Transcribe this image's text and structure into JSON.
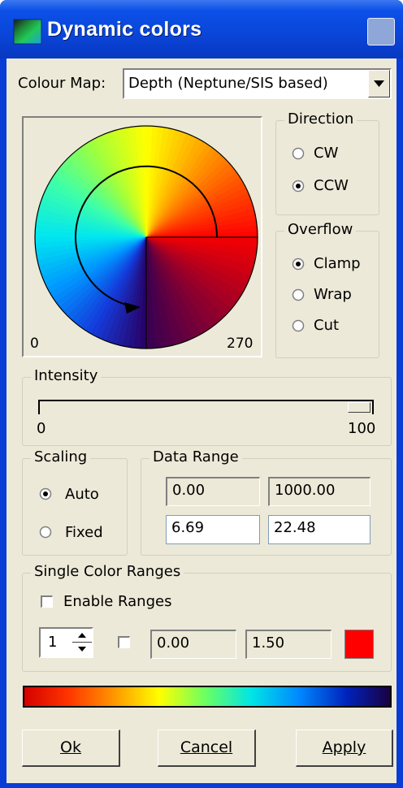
{
  "window": {
    "title": "Dynamic colors"
  },
  "colour_map": {
    "label": "Colour Map:",
    "selected": "Depth (Neptune/SIS based)"
  },
  "wheel": {
    "min_label": "0",
    "max_label": "270",
    "start_angle_deg": 0,
    "end_angle_deg": 270
  },
  "direction": {
    "title": "Direction",
    "options": [
      "CW",
      "CCW"
    ],
    "selected": "CCW"
  },
  "overflow": {
    "title": "Overflow",
    "options": [
      "Clamp",
      "Wrap",
      "Cut"
    ],
    "selected": "Clamp"
  },
  "intensity": {
    "title": "Intensity",
    "min": "0",
    "max": "100",
    "value": 100
  },
  "scaling": {
    "title": "Scaling",
    "options": [
      "Auto",
      "Fixed"
    ],
    "selected": "Auto"
  },
  "data_range": {
    "title": "Data Range",
    "min": "0.00",
    "max": "1000.00",
    "low": "6.69",
    "high": "22.48"
  },
  "single_color_ranges": {
    "title": "Single Color Ranges",
    "enable_label": "Enable Ranges",
    "enabled": false,
    "index": "1",
    "row_enabled": false,
    "from": "0.00",
    "to": "1.50",
    "color": "#ff0000"
  },
  "buttons": {
    "ok": "Ok",
    "cancel": "Cancel",
    "apply": "Apply"
  }
}
